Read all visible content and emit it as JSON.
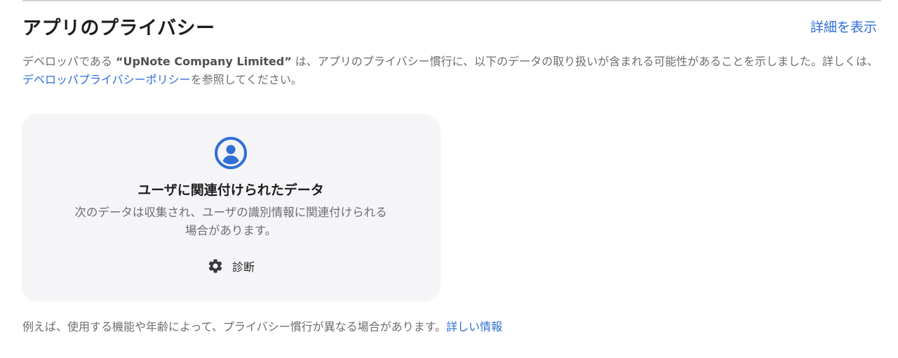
{
  "section": {
    "title": "アプリのプライバシー",
    "details_link": "詳細を表示"
  },
  "description": {
    "prefix": "デベロッパである ",
    "developer": "“UpNote Company Limited”",
    "middle": " は、アプリのプライバシー慣行に、以下のデータの取り扱いが含まれる可能性があることを示しました。詳しくは、",
    "policy_link": "デベロッパプライバシーポリシー",
    "suffix": "を参照してください。"
  },
  "card": {
    "icon": "person-circle-icon",
    "title": "ユーザに関連付けられたデータ",
    "description": "次のデータは収集され、ユーザの識別情報に関連付けられる場合があります。",
    "items": [
      {
        "icon": "gear-icon",
        "label": "診断"
      }
    ]
  },
  "footer": {
    "note": "例えば、使用する機能や年齢によって、プライバシー慣行が異なる場合があります。",
    "more_link": "詳しい情報"
  },
  "colors": {
    "accent": "#2f6fd6",
    "card_bg": "#f5f5f7",
    "secondary_text": "#6e6e73"
  }
}
